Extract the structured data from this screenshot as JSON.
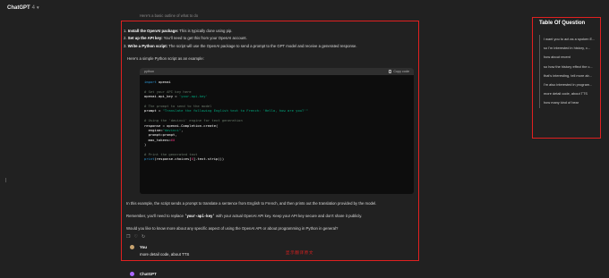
{
  "header": {
    "model": "ChatGPT",
    "version": "4"
  },
  "top_faded": "Here's a basic outline of what to do",
  "steps": [
    {
      "num": "1.",
      "bold": "Install the OpenAI package:",
      "text": " This is typically done using pip."
    },
    {
      "num": "2.",
      "bold": "Set up the API key:",
      "text": " You'll need to get this from your OpenAI account."
    },
    {
      "num": "3.",
      "bold": "Write a Python script:",
      "text": " The script will use the OpenAI package to send a prompt to the GPT model and receive a generated response."
    }
  ],
  "intro": "Here's a simple Python script as an example:",
  "code": {
    "language": "python",
    "copy_label": "Copy code",
    "lines": [
      [
        [
          "kw",
          "import"
        ],
        [
          "",
          " openai"
        ]
      ],
      [],
      [
        [
          "cm",
          "# Set your API key here"
        ]
      ],
      [
        [
          "",
          "openai.api_key = "
        ],
        [
          "st",
          "'your-api-key'"
        ]
      ],
      [],
      [
        [
          "cm",
          "# The prompt to send to the model"
        ]
      ],
      [
        [
          "",
          "prompt = "
        ],
        [
          "st",
          "\"Translate the following English text to French: 'Hello, how are you?'\""
        ]
      ],
      [],
      [
        [
          "cm",
          "# Using the 'davinci' engine for text generation"
        ]
      ],
      [
        [
          "",
          "response = openai.Completion.create("
        ]
      ],
      [
        [
          "",
          "  engine="
        ],
        [
          "st",
          "\"davinci\""
        ],
        [
          "",
          ","
        ]
      ],
      [
        [
          "",
          "  prompt=prompt,"
        ]
      ],
      [
        [
          "",
          "  max_tokens="
        ],
        [
          "nm",
          "60"
        ]
      ],
      [
        [
          "",
          ")"
        ]
      ],
      [],
      [
        [
          "cm",
          "# Print the generated text"
        ]
      ],
      [
        [
          "kw",
          "print"
        ],
        [
          "",
          "(response.choices["
        ],
        [
          "nm",
          "0"
        ],
        [
          "",
          "].text.strip())"
        ]
      ]
    ]
  },
  "para1": "In this example, the script sends a prompt to translate a sentence from English to French, and then prints out the translation provided by the model.",
  "para2_before": "Remember, you'll need to replace ",
  "para2_code": "'your-api-key'",
  "para2_after": " with your actual OpenAI API key. Keep your API key secure and don't share it publicly.",
  "para3": "Would you like to know more about any specific aspect of using the OpenAI API or about programming in Python in general?",
  "actions": {
    "copy": "❐",
    "like": "♡",
    "regen": "↻"
  },
  "user": {
    "name": "You",
    "message": "more detail code, about TTS"
  },
  "translated_label": "显示翻译原文",
  "assistant": {
    "name": "ChatGPT"
  },
  "toc": {
    "title": "Table Of Question",
    "items": [
      "I want you to act as a spoken E...",
      "so I'm interested in history, c...",
      "how about recent",
      "so how the history effect the c...",
      "that's interesting, tell more ab...",
      "I'm also interested in program...",
      "more detail code, about TTS",
      "how many kind of bear"
    ]
  },
  "colors": {
    "background": "#212121",
    "highlight_border": "#e02020",
    "code_bg": "#0d0d0d"
  }
}
